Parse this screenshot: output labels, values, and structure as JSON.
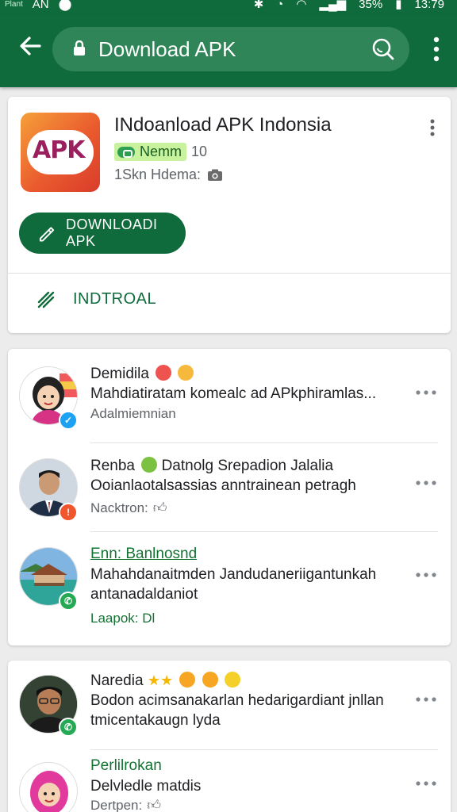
{
  "status_bar": {
    "left_small": "Plant",
    "carrier": "AN",
    "battery": "35%",
    "time": "13:79"
  },
  "app_bar": {
    "url_text": "Download APK",
    "colors": {
      "bar": "#0f6b3b",
      "url_box": "#2f8558"
    }
  },
  "app_card": {
    "logo_text": "APK",
    "title": "INdoanload APK Indonsia",
    "badge_label": "Nemm",
    "version": "10",
    "meta_text": "1Skn Hdema:",
    "download_button": "DOWNLOADI APK",
    "install_label": "INDTROAL"
  },
  "posts": [
    {
      "name": "Demidila",
      "body_line1": "Mahdiatiratam komealc ad APkphiramlas...",
      "meta": "Adalmiemnian",
      "avatar_icon": "woman-avatar",
      "badge_icon": "twitter-icon"
    },
    {
      "name": "Renba",
      "name_suffix": "Datnolg Srepadion Jalalia",
      "body_line1": "Ooianlaotalsassias anntrainean petragh",
      "meta": "Nacktron:",
      "avatar_icon": "man-avatar",
      "badge_icon": "alert-icon"
    },
    {
      "name": "Enn: Banlnosnd",
      "body_line1": "Mahahdanaitmden Jandudaneriigantunkah",
      "body_line2": "antanadaldaniot",
      "meta": "Laapok: Dl",
      "avatar_icon": "resort-photo",
      "badge_icon": "whatsapp-icon"
    }
  ],
  "posts2": [
    {
      "name": "Naredia",
      "body_line1": "Bodon acimsanakarlan hedarigardiant jnllan",
      "body_line2": "tmicentakaugn lyda",
      "avatar_icon": "man-glasses-avatar",
      "badge_icon": "whatsapp-icon"
    },
    {
      "name": "Perlilrokan",
      "body_line1": "Delvledle matdis",
      "meta": "Dertpen:",
      "avatar_icon": "woman-hijab-avatar",
      "badge_icon": "whatsapp-icon"
    }
  ]
}
